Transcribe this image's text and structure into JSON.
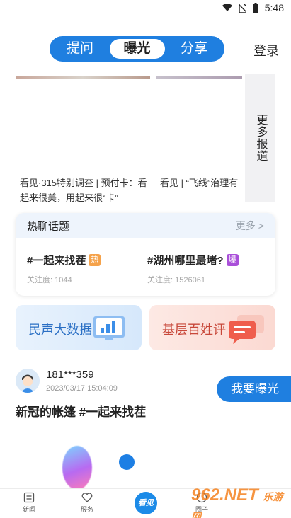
{
  "status_bar": {
    "time": "5:48"
  },
  "header": {
    "tabs": [
      {
        "label": "提问",
        "active": false
      },
      {
        "label": "曝光",
        "active": true
      },
      {
        "label": "分享",
        "active": false
      }
    ],
    "login_label": "登录"
  },
  "news": {
    "items": [
      {
        "title": "看见·315特别调查 | 预付卡：看起来很美，用起来很“卡”"
      },
      {
        "title": "看见 | “飞线”治理有"
      }
    ],
    "more_label": "更多报道"
  },
  "hot_topics": {
    "title": "热聊话题",
    "more_label": "更多 >",
    "topics": [
      {
        "name": "#一起来找茬",
        "badge": "热",
        "followers": "关注度: 1044"
      },
      {
        "name": "#湖州哪里最堵?",
        "badge": "爆",
        "followers": "关注度: 1526061"
      }
    ]
  },
  "features": [
    {
      "label": "民声大数据"
    },
    {
      "label": "基层百姓评"
    }
  ],
  "post": {
    "username": "181***359",
    "time": "2023/03/17 15:04:09",
    "title": "新冠的帐篷 #一起来找茬"
  },
  "expose_button": "我要曝光",
  "bottom_nav": {
    "items": [
      {
        "label": "新闻"
      },
      {
        "label": "服务"
      },
      {
        "label": "看见"
      },
      {
        "label": "圈子"
      }
    ]
  },
  "watermark": {
    "text": "962.NET",
    "sub": "乐游网"
  },
  "colors": {
    "brand_blue": "#1f7fe0",
    "hot_badge": "#f5a24a",
    "boom_badge": "#a94fd9"
  }
}
